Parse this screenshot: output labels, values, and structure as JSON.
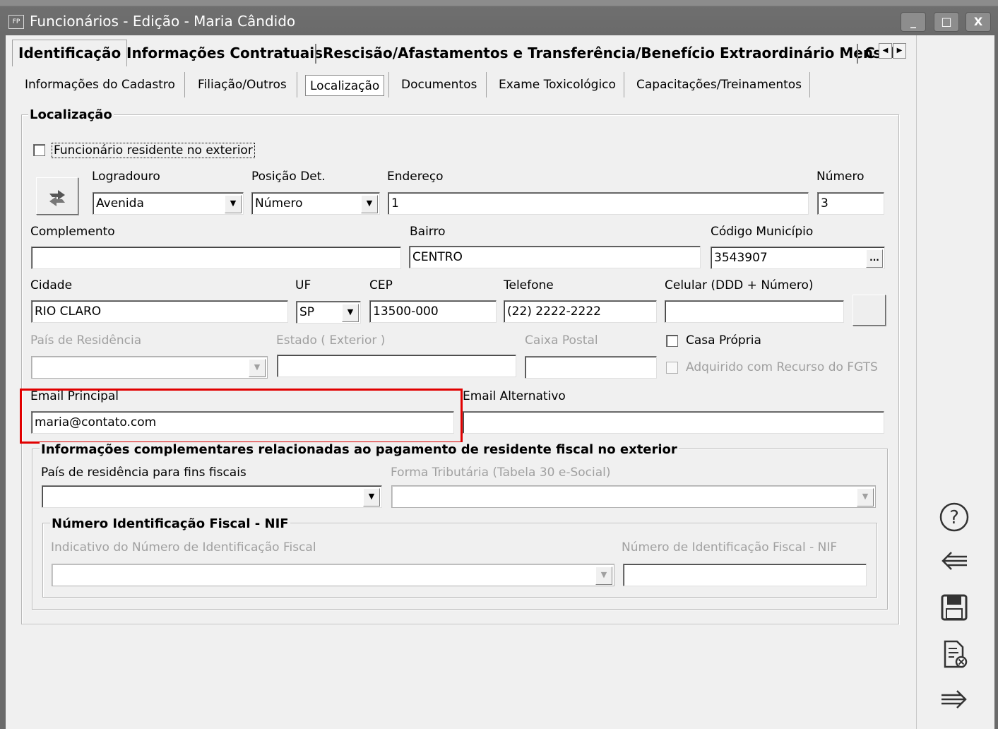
{
  "window": {
    "icon": "FP",
    "title": "Funcionários - Edição - Maria Cândido",
    "controls": {
      "minimize": "_",
      "maximize": "□",
      "close": "X"
    }
  },
  "main_tabs": [
    {
      "label": "Identificação"
    },
    {
      "label": "Informações Contratuais"
    },
    {
      "label": "Rescisão/Afastamentos e Transferência/Benefício Extraordinário Mensal"
    },
    {
      "label": "C"
    }
  ],
  "sub_tabs": [
    {
      "label": "Informações do Cadastro"
    },
    {
      "label": "Filiação/Outros"
    },
    {
      "label": "Localização"
    },
    {
      "label": "Documentos"
    },
    {
      "label": "Exame Toxicológico"
    },
    {
      "label": "Capacitações/Treinamentos"
    }
  ],
  "localizacao": {
    "legend": "Localização",
    "residente_exterior": {
      "label": "Funcionário residente no exterior",
      "checked": false
    },
    "logradouro": {
      "label": "Logradouro",
      "value": "Avenida"
    },
    "posicao_det": {
      "label": "Posição Det.",
      "value": "Número"
    },
    "endereco": {
      "label": "Endereço",
      "value": "1"
    },
    "numero": {
      "label": "Número",
      "value": "3"
    },
    "complemento": {
      "label": "Complemento",
      "value": ""
    },
    "bairro": {
      "label": "Bairro",
      "value": "CENTRO"
    },
    "codigo_municipio": {
      "label": "Código Município",
      "value": "3543907",
      "button": "..."
    },
    "cidade": {
      "label": "Cidade",
      "value": "RIO CLARO"
    },
    "uf": {
      "label": "UF",
      "value": "SP"
    },
    "cep": {
      "label": "CEP",
      "value": "13500-000"
    },
    "telefone": {
      "label": "Telefone",
      "value": "(22) 2222-2222"
    },
    "celular": {
      "label": "Celular (DDD + Número)",
      "value": ""
    },
    "pais_residencia": {
      "label": "País de Residência",
      "value": ""
    },
    "estado_exterior": {
      "label": "Estado ( Exterior )",
      "value": ""
    },
    "caixa_postal": {
      "label": "Caixa Postal",
      "value": ""
    },
    "casa_propria": {
      "label": "Casa Própria",
      "checked": false
    },
    "adquirido_fgts": {
      "label": "Adquirido com Recurso do FGTS",
      "checked": false
    },
    "email_principal": {
      "label": "Email Principal",
      "value": "maria@contato.com"
    },
    "email_alternativo": {
      "label": "Email Alternativo",
      "value": ""
    }
  },
  "complementares": {
    "legend": "Informações complementares relacionadas ao pagamento de residente fiscal no exterior",
    "pais_fiscal": {
      "label": "País de residência para fins fiscais",
      "value": ""
    },
    "forma_tributaria": {
      "label": "Forma Tributária (Tabela 30 e-Social)",
      "value": ""
    },
    "nif": {
      "legend": "Número Identificação Fiscal - NIF",
      "indicativo": {
        "label": "Indicativo do Número de Identificação Fiscal",
        "value": ""
      },
      "numero": {
        "label": "Número de Identificação Fiscal - NIF",
        "value": ""
      }
    }
  },
  "side_toolbar": [
    "help-icon",
    "back-arrow-icon",
    "save-icon",
    "cancel-document-icon",
    "forward-arrow-icon"
  ],
  "colors": {
    "highlight_box": "#e10000",
    "titlebar": "#6a6a6a"
  }
}
